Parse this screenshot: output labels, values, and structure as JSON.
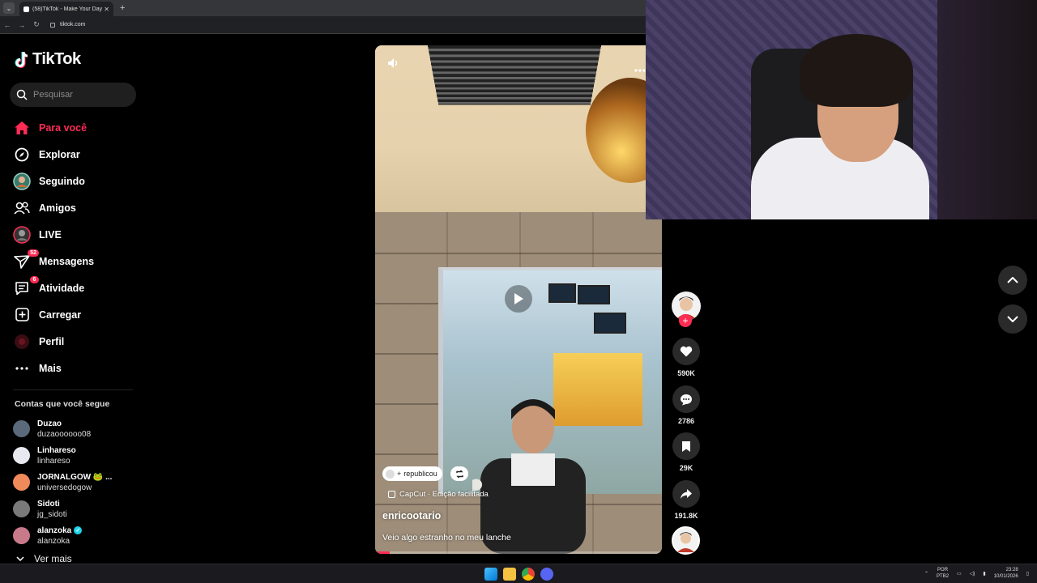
{
  "browser": {
    "tab_title": "(58)TikTok - Make Your Day",
    "url": "tiktok.com"
  },
  "sidebar": {
    "logo_text": "TikTok",
    "search_placeholder": "Pesquisar",
    "nav": [
      {
        "label": "Para você",
        "icon": "home-icon",
        "active": true
      },
      {
        "label": "Explorar",
        "icon": "compass-icon"
      },
      {
        "label": "Seguindo",
        "icon": "following-avatar-icon"
      },
      {
        "label": "Amigos",
        "icon": "friends-icon"
      },
      {
        "label": "LIVE",
        "icon": "live-icon"
      },
      {
        "label": "Mensagens",
        "icon": "messages-icon",
        "badge": "52"
      },
      {
        "label": "Atividade",
        "icon": "activity-icon",
        "badge": "6"
      },
      {
        "label": "Carregar",
        "icon": "upload-icon"
      },
      {
        "label": "Perfil",
        "icon": "profile-icon"
      },
      {
        "label": "Mais",
        "icon": "more-icon"
      }
    ],
    "following_title": "Contas que você segue",
    "accounts": [
      {
        "name": "Duzao",
        "handle": "duzaoooooo08",
        "color": "#5a6a7a"
      },
      {
        "name": "Linhareso",
        "handle": "linhareso",
        "color": "#e8e8f0"
      },
      {
        "name": "JORNALGOW 🐸 ...",
        "handle": "universedogow",
        "color": "#f08a5a"
      },
      {
        "name": "Sidoti",
        "handle": "jg_sidoti",
        "color": "#7a7a7a"
      },
      {
        "name": "alanzoka",
        "handle": "alanzoka",
        "color": "#c87a8a",
        "verified": true
      }
    ],
    "see_more": "Ver mais"
  },
  "video": {
    "repost_label": "republicou",
    "capcut_label": "CapCut · Edição facilitada",
    "author": "enricootario",
    "caption": "Veio algo estranho no meu lanche",
    "progress": 0.05
  },
  "actions": {
    "likes": "590K",
    "comments": "2786",
    "saves": "29K",
    "shares": "191.8K"
  },
  "taskbar": {
    "lang_top": "POR",
    "lang_bottom": "PTB2",
    "time": "23:28",
    "date": "10/01/2026"
  },
  "colors": {
    "accent": "#fe2c55",
    "background": "#000000"
  }
}
